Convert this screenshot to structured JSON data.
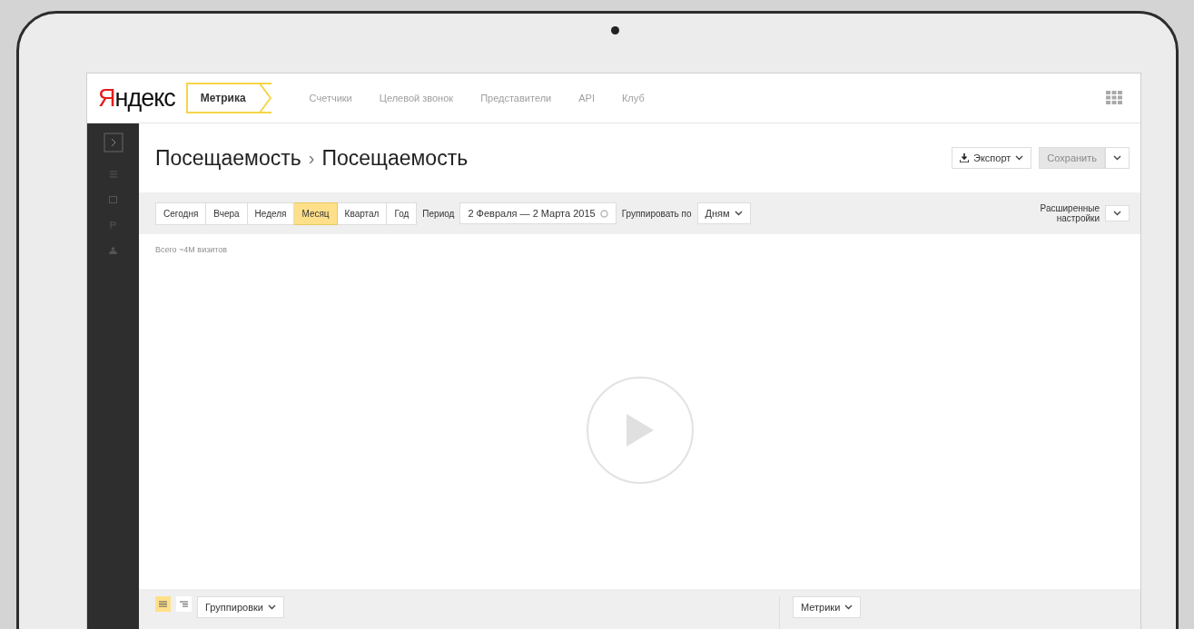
{
  "logo": {
    "brand": "Яндекс",
    "product": "Метрика"
  },
  "nav": [
    "Счетчики",
    "Целевой звонок",
    "Представители",
    "API",
    "Клуб"
  ],
  "breadcrumb": {
    "parent": "Посещаемость",
    "separator": "›",
    "current": "Посещаемость"
  },
  "actions": {
    "export": "Экспорт",
    "save": "Сохранить",
    "save_disabled": true
  },
  "periods": [
    {
      "label": "Сегодня",
      "selected": false
    },
    {
      "label": "Вчера",
      "selected": false
    },
    {
      "label": "Неделя",
      "selected": false
    },
    {
      "label": "Месяц",
      "selected": true
    },
    {
      "label": "Квартал",
      "selected": false
    },
    {
      "label": "Год",
      "selected": false
    }
  ],
  "period_label": "Период",
  "date_range": "2 Февраля — 2 Марта 2015",
  "group_label": "Группировать по",
  "group_value": "Дням",
  "advanced": "Расширенные настройки",
  "summary": "Всего ~4М визитов",
  "view_modes": [
    {
      "kind": "list",
      "selected": true
    },
    {
      "kind": "tree",
      "selected": false
    }
  ],
  "groupings": "Группировки",
  "metrics": "Метрики"
}
